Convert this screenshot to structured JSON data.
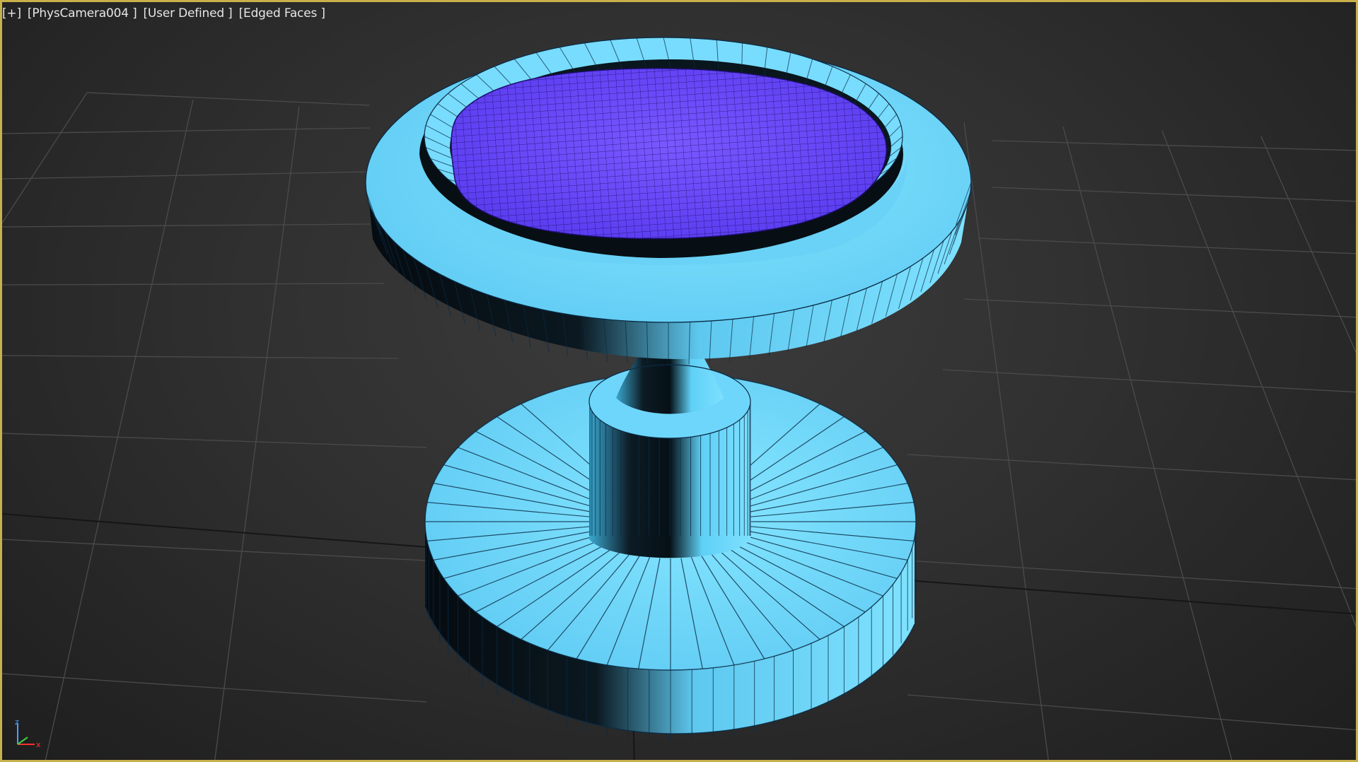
{
  "viewport": {
    "label_plus": "[+]",
    "label_camera": "[PhysCamera004 ]",
    "label_shading": "[User Defined ]",
    "label_display": "[Edged Faces ]",
    "border_color": "#c8b14a",
    "background_color": "#2f2f2f",
    "grid_color": "#4a4a4a",
    "grid_major_color": "#141414"
  },
  "object": {
    "name": "fountain",
    "body_color": "#6fd7ff",
    "shadow_color": "#0a1a24",
    "wire_color": "#0a2a44",
    "liquid_color": "#6a46ff",
    "liquid_wire_color": "#1c0e6a"
  },
  "axis_gizmo": {
    "z_label": "z",
    "x_label": "x",
    "z_color": "#4aa0ff",
    "x_color": "#ff3030",
    "y_color": "#40d040"
  }
}
